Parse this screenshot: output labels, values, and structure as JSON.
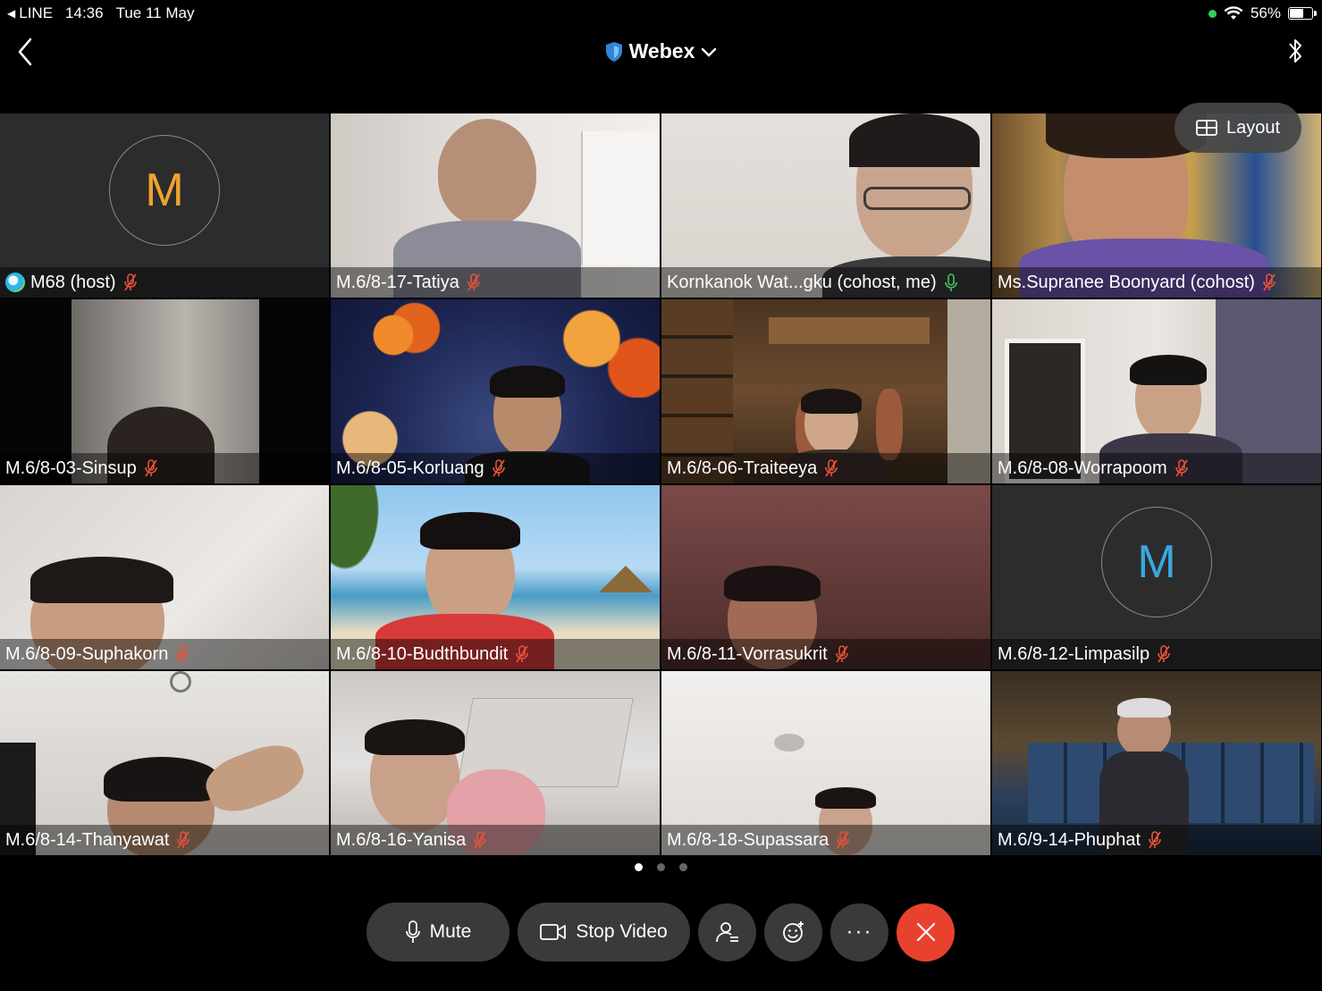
{
  "status_bar": {
    "back_app": "LINE",
    "time": "14:36",
    "date": "Tue 11 May",
    "battery": "56%"
  },
  "header": {
    "title": "Webex"
  },
  "layout_button": "Layout",
  "participants": [
    {
      "name": "M68 (host)",
      "avatar_initial": "M",
      "avatar_color": "#f0a32e"
    },
    {
      "name": "M.6/8-17-Tatiya"
    },
    {
      "name": "Kornkanok Wat...gku (cohost, me)"
    },
    {
      "name": "Ms.Supranee Boonyard (cohost)"
    },
    {
      "name": "M.6/8-03-Sinsup"
    },
    {
      "name": "M.6/8-05-Korluang"
    },
    {
      "name": "M.6/8-06-Traiteeya"
    },
    {
      "name": "M.6/8-08-Worrapoom"
    },
    {
      "name": "M.6/8-09-Suphakorn"
    },
    {
      "name": "M.6/8-10-Budthbundit"
    },
    {
      "name": "M.6/8-11-Vorrasukrit"
    },
    {
      "name": "M.6/8-12-Limpasilp",
      "avatar_initial": "M",
      "avatar_color": "#3aa7e0"
    },
    {
      "name": "M.6/8-14-Thanyawat"
    },
    {
      "name": "M.6/8-16-Yanisa"
    },
    {
      "name": "M.6/8-18-Supassara"
    },
    {
      "name": "M.6/9-14-Phuphat"
    }
  ],
  "controls": {
    "mute": "Mute",
    "stop_video": "Stop Video",
    "more": "···"
  },
  "colors": {
    "muted_mic": "#e8523a",
    "active_mic": "#3cc85a",
    "active_border": "#2d9bd6",
    "end_call": "#e8422f"
  }
}
